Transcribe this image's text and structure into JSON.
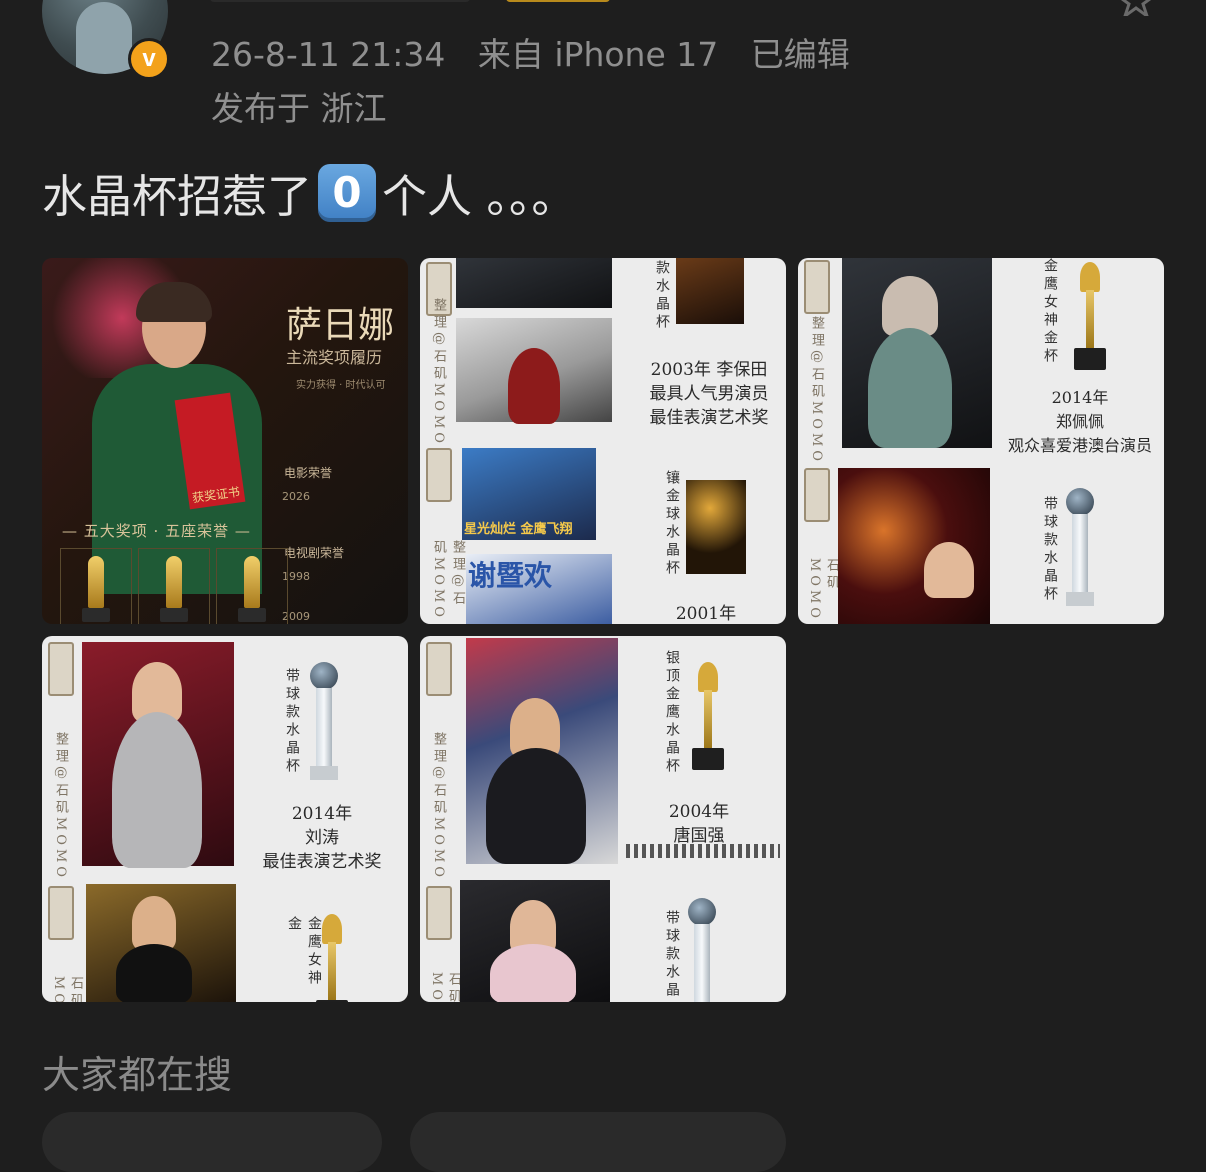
{
  "post": {
    "meta_line1": [
      "26-8-11 21:34",
      "来自 iPhone 17",
      "已编辑"
    ],
    "location": "发布于 浙江",
    "text_before": "水晶杯招惹了",
    "keycap": "0",
    "text_after": "个人 。。。",
    "verified_badge": "v"
  },
  "images": {
    "img1": {
      "name": "萨日娜",
      "subtitle": "主流奖项履历",
      "tagline": "实力获得 · 时代认可",
      "section_film": "电影荣誉",
      "section_tv": "电视剧荣誉",
      "year_2026": "2026",
      "year_1998": "1998",
      "year_2009": "2009",
      "banner": "— 五大奖项 · 五座荣誉 —",
      "certificate": "获奖证书"
    },
    "img2": {
      "vertical_credit": "整理@石矶MOMO",
      "trophy_label_top": "款水晶杯",
      "caption": [
        "2003年 李保田",
        "最具人气男演员",
        "最佳表演艺术奖"
      ],
      "trophy_label_mid": "镶金球水晶杯",
      "photo_banner": "星光灿烂 金鹰飞翔",
      "photo_banner2": "谢暨欢",
      "year_bottom": "2001年"
    },
    "img3": {
      "vertical_credit": "整理@石矶MOMO",
      "trophy_label_top": "金鹰女神金杯",
      "caption": [
        "2014年",
        "郑佩佩",
        "观众喜爱港澳台演员"
      ],
      "trophy_label_bottom": "带球款水晶杯"
    },
    "img4": {
      "vertical_credit": "整理@石矶MOMO",
      "trophy_label_top": "带球款水晶杯",
      "caption": [
        "2014年",
        "刘涛",
        "最佳表演艺术奖"
      ],
      "trophy_label_bottom": "金鹰女神金"
    },
    "img5": {
      "vertical_credit": "整理@石矶MOMO",
      "trophy_label_top": "银顶金鹰水晶杯",
      "caption": [
        "2004年",
        "唐国强"
      ],
      "trophy_label_bottom": "带球款水晶"
    }
  },
  "section": {
    "title": "大家都在搜"
  },
  "colors": {
    "background": "#1e1e1e",
    "badge": "#f3a21b",
    "keycap": "#4a8fd2"
  },
  "icons": [
    "star-icon",
    "verified-badge-icon",
    "keycap-zero-icon",
    "trophy-icon"
  ]
}
